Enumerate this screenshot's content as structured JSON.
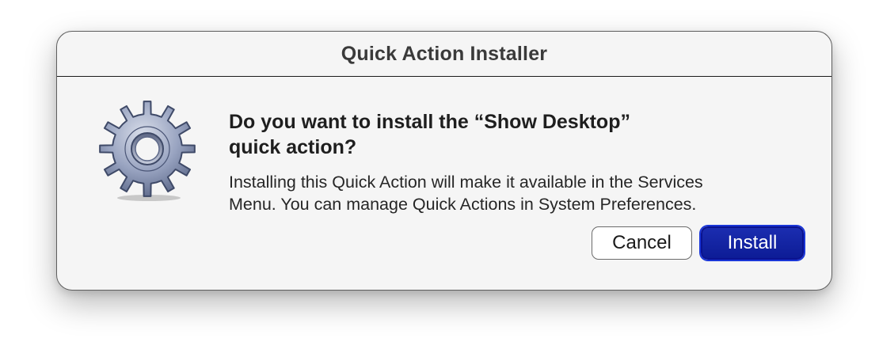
{
  "dialog": {
    "title": "Quick Action Installer",
    "icon": "gear-icon",
    "headline_line1": "Do you want to install the “Show Desktop”",
    "headline_line2": "quick action?",
    "body_line1": "Installing this Quick Action will make it available in the Services",
    "body_line2": "Menu. You can manage Quick Actions in System Preferences.",
    "cancel_label": "Cancel",
    "install_label": "Install"
  },
  "colors": {
    "default_button": "#0d1c96",
    "dialog_background": "#f5f5f5",
    "gear": "#8a96b5"
  }
}
